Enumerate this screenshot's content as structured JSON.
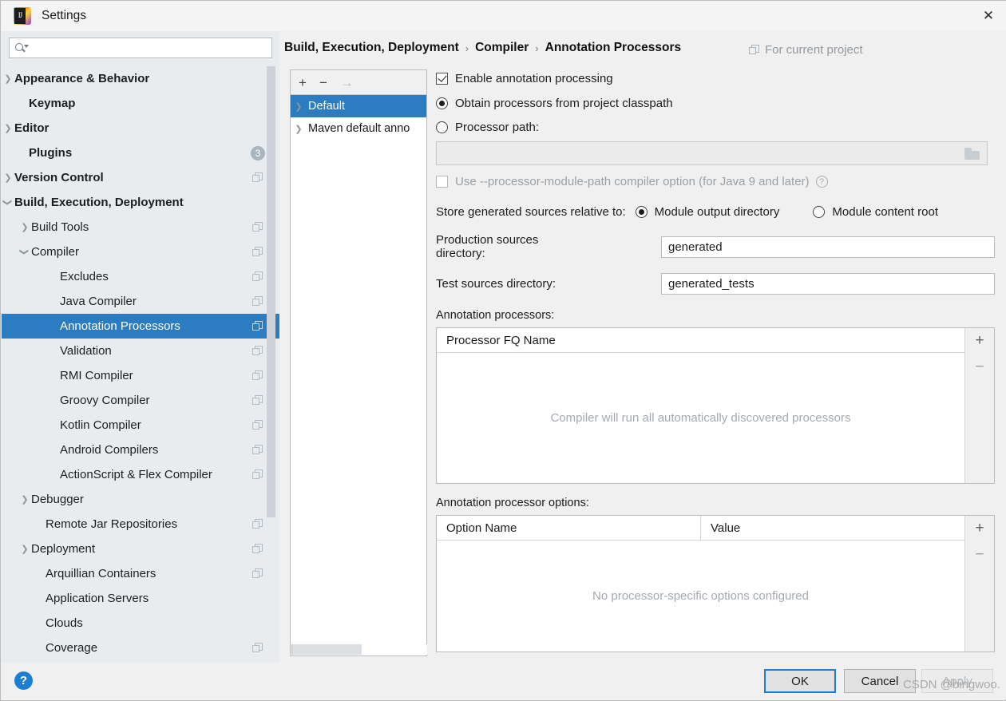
{
  "window": {
    "title": "Settings",
    "logo_icon": "intellij-idea-logo",
    "close_icon": "close-icon"
  },
  "search": {
    "value": "",
    "placeholder": "",
    "icon": "search-icon"
  },
  "sidebar": {
    "items": [
      {
        "label": "Appearance & Behavior",
        "arrow": "right",
        "bold": true,
        "indent": 16,
        "copy": false,
        "badge": null,
        "selected": false
      },
      {
        "label": "Keymap",
        "arrow": "none",
        "bold": true,
        "indent": 34,
        "copy": false,
        "badge": null,
        "selected": false
      },
      {
        "label": "Editor",
        "arrow": "right",
        "bold": true,
        "indent": 16,
        "copy": false,
        "badge": null,
        "selected": false
      },
      {
        "label": "Plugins",
        "arrow": "none",
        "bold": true,
        "indent": 34,
        "copy": false,
        "badge": "3",
        "selected": false
      },
      {
        "label": "Version Control",
        "arrow": "right",
        "bold": true,
        "indent": 16,
        "copy": true,
        "badge": null,
        "selected": false
      },
      {
        "label": "Build, Execution, Deployment",
        "arrow": "down",
        "bold": true,
        "indent": 16,
        "copy": false,
        "badge": null,
        "selected": false
      },
      {
        "label": "Build Tools",
        "arrow": "right",
        "bold": false,
        "indent": 37,
        "copy": true,
        "badge": null,
        "selected": false
      },
      {
        "label": "Compiler",
        "arrow": "down",
        "bold": false,
        "indent": 37,
        "copy": true,
        "badge": null,
        "selected": false
      },
      {
        "label": "Excludes",
        "arrow": "none",
        "bold": false,
        "indent": 73,
        "copy": true,
        "badge": null,
        "selected": false
      },
      {
        "label": "Java Compiler",
        "arrow": "none",
        "bold": false,
        "indent": 73,
        "copy": true,
        "badge": null,
        "selected": false
      },
      {
        "label": "Annotation Processors",
        "arrow": "none",
        "bold": false,
        "indent": 73,
        "copy": true,
        "badge": null,
        "selected": true
      },
      {
        "label": "Validation",
        "arrow": "none",
        "bold": false,
        "indent": 73,
        "copy": true,
        "badge": null,
        "selected": false
      },
      {
        "label": "RMI Compiler",
        "arrow": "none",
        "bold": false,
        "indent": 73,
        "copy": true,
        "badge": null,
        "selected": false
      },
      {
        "label": "Groovy Compiler",
        "arrow": "none",
        "bold": false,
        "indent": 73,
        "copy": true,
        "badge": null,
        "selected": false
      },
      {
        "label": "Kotlin Compiler",
        "arrow": "none",
        "bold": false,
        "indent": 73,
        "copy": true,
        "badge": null,
        "selected": false
      },
      {
        "label": "Android Compilers",
        "arrow": "none",
        "bold": false,
        "indent": 73,
        "copy": true,
        "badge": null,
        "selected": false
      },
      {
        "label": "ActionScript & Flex Compiler",
        "arrow": "none",
        "bold": false,
        "indent": 73,
        "copy": true,
        "badge": null,
        "selected": false
      },
      {
        "label": "Debugger",
        "arrow": "right",
        "bold": false,
        "indent": 37,
        "copy": false,
        "badge": null,
        "selected": false
      },
      {
        "label": "Remote Jar Repositories",
        "arrow": "none",
        "bold": false,
        "indent": 55,
        "copy": true,
        "badge": null,
        "selected": false
      },
      {
        "label": "Deployment",
        "arrow": "right",
        "bold": false,
        "indent": 37,
        "copy": true,
        "badge": null,
        "selected": false
      },
      {
        "label": "Arquillian Containers",
        "arrow": "none",
        "bold": false,
        "indent": 55,
        "copy": true,
        "badge": null,
        "selected": false
      },
      {
        "label": "Application Servers",
        "arrow": "none",
        "bold": false,
        "indent": 55,
        "copy": false,
        "badge": null,
        "selected": false
      },
      {
        "label": "Clouds",
        "arrow": "none",
        "bold": false,
        "indent": 55,
        "copy": false,
        "badge": null,
        "selected": false
      },
      {
        "label": "Coverage",
        "arrow": "none",
        "bold": false,
        "indent": 55,
        "copy": true,
        "badge": null,
        "selected": false
      }
    ]
  },
  "breadcrumb": {
    "part1": "Build, Execution, Deployment",
    "part2": "Compiler",
    "part3": "Annotation Processors",
    "separator": "›"
  },
  "scope": {
    "label": "For current project",
    "icon": "copy-icon"
  },
  "profiles": {
    "toolbar": {
      "add": "+",
      "remove": "−",
      "move": "→"
    },
    "items": [
      {
        "label": "Default",
        "selected": true
      },
      {
        "label": "Maven default anno",
        "selected": false
      }
    ]
  },
  "form": {
    "enable_processing": {
      "label": "Enable annotation processing",
      "checked": true
    },
    "source_mode": {
      "obtain_from_classpath": {
        "label": "Obtain processors from project classpath",
        "checked": true
      },
      "processor_path": {
        "label": "Processor path:",
        "checked": false
      }
    },
    "processor_path_value": "",
    "module_path_option": {
      "label": "Use --processor-module-path compiler option (for Java 9 and later)",
      "checked": false,
      "help_icon": "help-icon"
    },
    "store_relative": {
      "label": "Store generated sources relative to:",
      "option_output": {
        "label": "Module output directory",
        "checked": true
      },
      "option_content": {
        "label": "Module content root",
        "checked": false
      }
    },
    "production_dir": {
      "label": "Production sources directory:",
      "value": "generated"
    },
    "test_dir": {
      "label": "Test sources directory:",
      "value": "generated_tests"
    },
    "processors_table": {
      "label": "Annotation processors:",
      "columns": [
        "Processor FQ Name"
      ],
      "rows": [],
      "empty_text": "Compiler will run all automatically discovered processors",
      "add": "+",
      "remove": "−"
    },
    "options_table": {
      "label": "Annotation processor options:",
      "columns": [
        "Option Name",
        "Value"
      ],
      "rows": [],
      "empty_text": "No processor-specific options configured",
      "add": "+",
      "remove": "−"
    }
  },
  "footer": {
    "help": "?",
    "ok": "OK",
    "cancel": "Cancel",
    "apply": "Apply"
  },
  "watermark": "CSDN @bingwoo.",
  "colors": {
    "selection_blue": "#2b7cc0",
    "accent_blue": "#1a7fd4",
    "sidebar_bg": "#e8ecef",
    "content_bg": "#f0f0f0",
    "muted_text": "#a5aab0"
  }
}
